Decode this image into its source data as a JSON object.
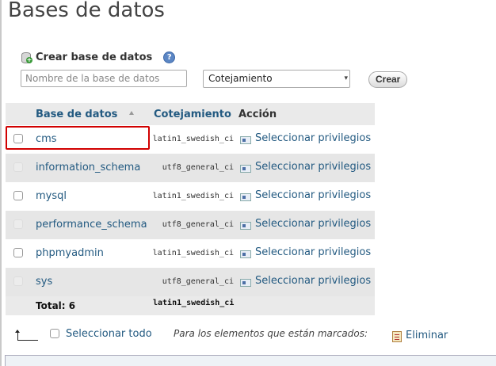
{
  "page": {
    "title": "Bases de datos"
  },
  "create": {
    "label": "Crear base de datos",
    "name_placeholder": "Nombre de la base de datos",
    "collation_value": "Cotejamiento",
    "button_label": "Crear"
  },
  "table": {
    "headers": {
      "name": "Base de datos",
      "collation": "Cotejamiento",
      "action": "Acción"
    },
    "rows": [
      {
        "name": "cms",
        "collation": "latin1_swedish_ci",
        "action": "Seleccionar privilegios"
      },
      {
        "name": "information_schema",
        "collation": "utf8_general_ci",
        "action": "Seleccionar privilegios"
      },
      {
        "name": "mysql",
        "collation": "latin1_swedish_ci",
        "action": "Seleccionar privilegios"
      },
      {
        "name": "performance_schema",
        "collation": "utf8_general_ci",
        "action": "Seleccionar privilegios"
      },
      {
        "name": "phpmyadmin",
        "collation": "latin1_swedish_ci",
        "action": "Seleccionar privilegios"
      },
      {
        "name": "sys",
        "collation": "utf8_general_ci",
        "action": "Seleccionar privilegios"
      }
    ],
    "total_label": "Total: 6",
    "total_collation": "latin1_swedish_ci"
  },
  "footer": {
    "select_all": "Seleccionar todo",
    "marked_text": "Para los elementos que están marcados:",
    "delete_label": "Eliminar"
  },
  "colors": {
    "link": "#235a81",
    "highlight": "#d10000",
    "row_alt": "#e6e6e6"
  }
}
